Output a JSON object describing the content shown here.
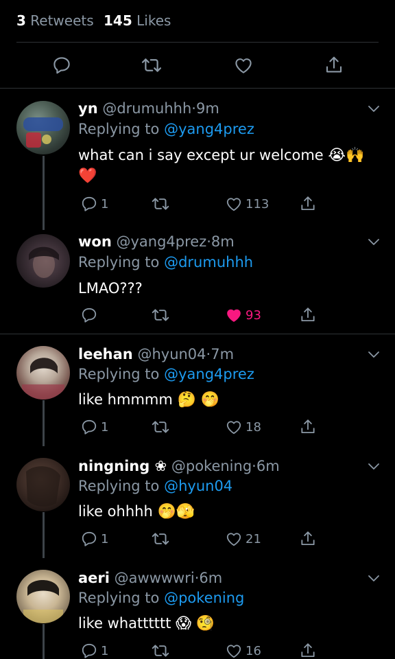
{
  "stats": {
    "retweets_count": "3",
    "retweets_label": "Retweets",
    "likes_count": "145",
    "likes_label": "Likes"
  },
  "replying_label": "Replying to",
  "replies": [
    {
      "name": "yn",
      "handle": "@drumuhhh",
      "dot": "·",
      "time": "9m",
      "replying_to": "@yang4prez",
      "text": "what can i say except ur welcome",
      "emojis": [
        "😭",
        "🙌"
      ],
      "text_line2": "❤️",
      "replies": "1",
      "likes": "113",
      "liked": false
    },
    {
      "name": "won",
      "handle": "@yang4prez",
      "dot": "·",
      "time": "8m",
      "replying_to": "@drumuhhh",
      "text": "LMAO???",
      "emojis": [],
      "replies": "",
      "likes": "93",
      "liked": true
    },
    {
      "name": "leehan",
      "handle": "@hyun04",
      "dot": "·",
      "time": "7m",
      "replying_to": "@yang4prez",
      "text": "like hmmmm",
      "emojis": [
        "🤔",
        "🤭"
      ],
      "replies": "1",
      "likes": "18",
      "liked": false
    },
    {
      "name": "ningning ❀",
      "handle": "@pokening",
      "dot": "·",
      "time": "6m",
      "replying_to": "@hyun04",
      "text": "like ohhhh",
      "emojis": [
        "🤭",
        "🫣"
      ],
      "replies": "1",
      "likes": "21",
      "liked": false
    },
    {
      "name": "aeri",
      "handle": "@awwwwri",
      "dot": "·",
      "time": "6m",
      "replying_to": "@pokening",
      "text": "like whatttttt",
      "emojis": [
        "😱",
        "🧐"
      ],
      "replies": "1",
      "likes": "16",
      "liked": false
    }
  ],
  "colors": {
    "background": "#000000",
    "secondary_text": "#8b98a5",
    "link": "#1d9bf0",
    "like_active": "#f91880",
    "divider": "#2f3336"
  }
}
